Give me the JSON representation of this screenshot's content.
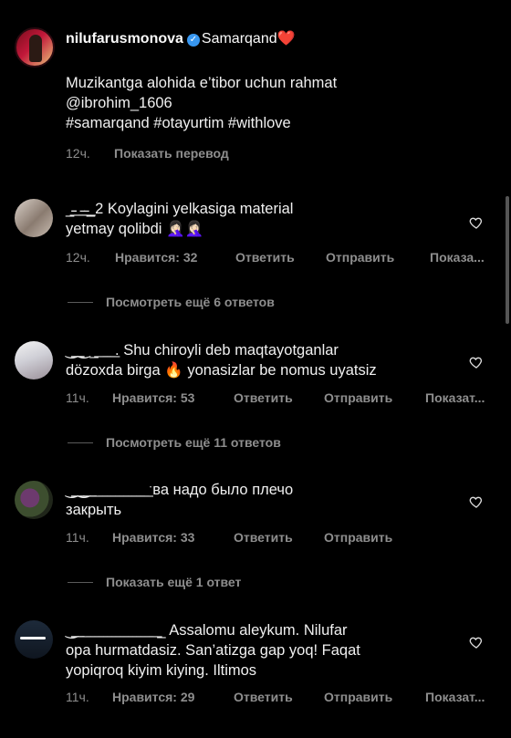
{
  "post": {
    "username": "nilufarusmonova",
    "location": "Samarqand❤️",
    "caption_line1": "Muzikantga alohida e’tibor uchun rahmat",
    "caption_line2": "@ibrohim_1606",
    "caption_line3": "#samarqand #otayurtim #withlove",
    "time": "12ч.",
    "translate": "Показать перевод"
  },
  "comments": [
    {
      "line1": "_̵̵͟ ͟ ̵͟ ̵͟_2 Koylagini yelkasiga material",
      "line2": "yetmay qolibdi 🤦🏻‍♀️🤦🏻‍♀️",
      "time": "12ч.",
      "likes": "Нравится: 32",
      "reply": "Ответить",
      "send": "Отправить",
      "translate": "Показа...",
      "more": "Посмотреть ещё 6 ответов"
    },
    {
      "line1": "‿͟‿_͟ ͟ ͟ ͟ . Shu chiroyli deb maqtayotganlar",
      "line2": "dözoxda birga 🔥 yonasizlar be nomus uyatsiz",
      "time": "11ч.",
      "likes": "Нравится: 53",
      "reply": "Ответить",
      "send": "Отправить",
      "translate": "Показат...",
      "more": "Посмотреть ещё 11 ответов"
    },
    {
      "line1": "‿͟‿͟ ͟ ͟ ͟ ͟ ͟ ͟ ͟ ͟ ͟ ͟ ͟ ͟ ͟ ˑва надо было плечо",
      "line2": "закрыть",
      "time": "11ч.",
      "likes": "Нравится: 33",
      "reply": "Ответить",
      "send": "Отправить",
      "translate": "",
      "more": "Показать ещё 1 ответ"
    },
    {
      "line1": "‿͟ ͟ ͟ ͟ ͟ ͟ ͟ ͟ ͟ ͟ ͟ ͟ ͟ ͟ ͟ ͟ ͟ ͟ ͟ _ Assalomu aleykum. Nilufar",
      "line2": "opa hurmatdasiz. San’atizga gap yoq! Faqat",
      "line3": "yopiqroq kiyim kiying. Iltimos",
      "time": "11ч.",
      "likes": "Нравится: 29",
      "reply": "Ответить",
      "send": "Отправить",
      "translate": "Показат..."
    }
  ]
}
